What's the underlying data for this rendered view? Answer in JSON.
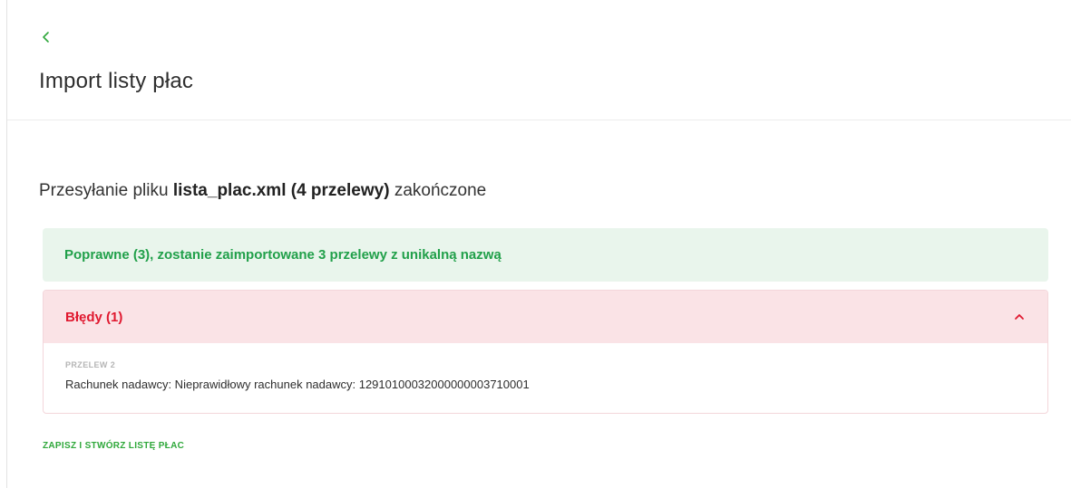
{
  "header": {
    "back_icon": "chevron-left-icon",
    "title": "Import listy płac"
  },
  "upload": {
    "prefix": "Przesyłanie pliku",
    "filename_info": "lista_plac.xml (4 przelewy)",
    "suffix": "zakończone"
  },
  "success": {
    "text": "Poprawne (3), zostanie zaimportowane 3 przelewy z unikalną nazwą",
    "color": "#21a04a",
    "background": "#e9f5ec"
  },
  "errors": {
    "title": "Błędy (1)",
    "toggle_icon": "chevron-up-icon",
    "expanded": true,
    "color": "#e0182f",
    "background": "#fae3e6",
    "items": [
      {
        "label": "PRZELEW 2",
        "message": "Rachunek nadawcy: Nieprawidłowy rachunek nadawcy: 12910100032000000003710001"
      }
    ]
  },
  "actions": {
    "save_label": "ZAPISZ I STWÓRZ LISTĘ PŁAC",
    "accent": "#2fa83b"
  }
}
